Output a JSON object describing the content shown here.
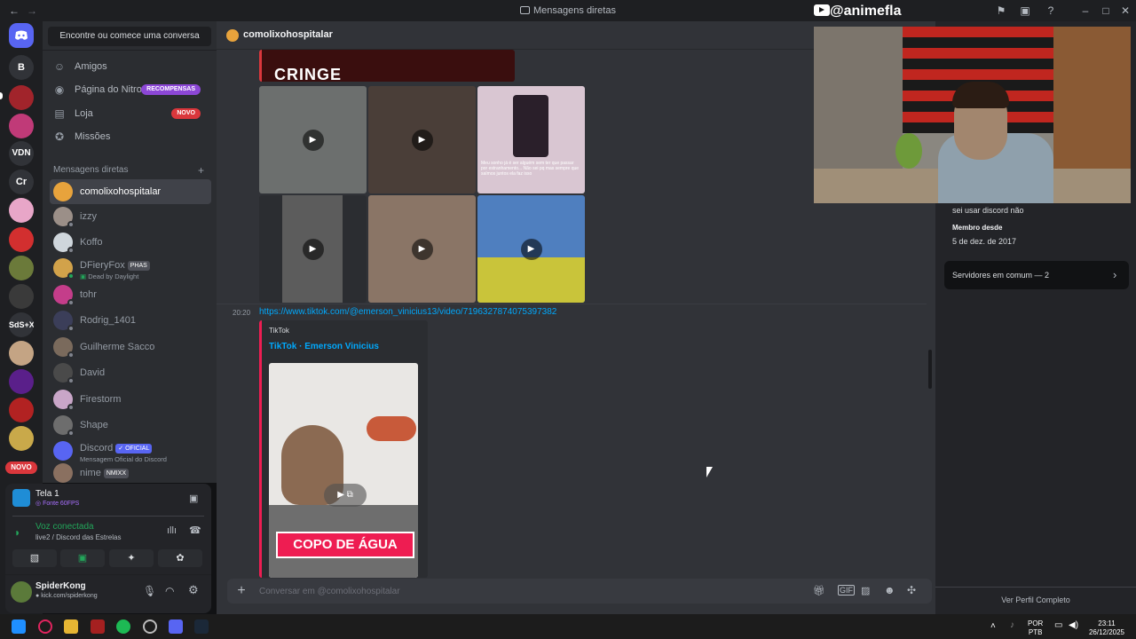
{
  "window": {
    "title": "Mensagens diretas"
  },
  "rail": {
    "letters": [
      "B",
      "VDN",
      "Cr",
      "SdS+X"
    ],
    "novo_badge": "NOVO"
  },
  "sidebar": {
    "search_label": "Encontre ou comece uma conversa",
    "nav": [
      {
        "label": "Amigos",
        "badge": ""
      },
      {
        "label": "Página do Nitro",
        "badge": "RECOMPENSAS"
      },
      {
        "label": "Loja",
        "badge": "NOVO"
      },
      {
        "label": "Missões",
        "badge": ""
      }
    ],
    "dm_header": "Mensagens diretas",
    "dms": [
      {
        "name": "comolixohospitalar",
        "sub": "",
        "tag": ""
      },
      {
        "name": "izzy",
        "sub": "",
        "tag": ""
      },
      {
        "name": "Koffo",
        "sub": "",
        "tag": ""
      },
      {
        "name": "DFieryFox",
        "sub": "Dead by Daylight",
        "tag": "PHAS"
      },
      {
        "name": "tohr",
        "sub": "",
        "tag": ""
      },
      {
        "name": "Rodrig_1401",
        "sub": "",
        "tag": ""
      },
      {
        "name": "Guilherme Sacco",
        "sub": "",
        "tag": ""
      },
      {
        "name": "David",
        "sub": "",
        "tag": ""
      },
      {
        "name": "Firestorm",
        "sub": "",
        "tag": ""
      },
      {
        "name": "Shape",
        "sub": "",
        "tag": ""
      },
      {
        "name": "Discord",
        "sub": "Mensagem Oficial do Discord",
        "tag": "OFICIAL"
      },
      {
        "name": "nime",
        "sub": "",
        "tag": "NMIXX"
      }
    ]
  },
  "panel": {
    "stream_title": "Tela 1",
    "stream_sub": "Fonte 60FPS",
    "voice_status": "Voz conectada",
    "voice_channel": "live2 / Discord das Estrelas",
    "user_name": "SpiderKong",
    "user_status": "kick.com/spiderkong"
  },
  "chat": {
    "recipient": "comolixohospitalar",
    "cringe_text": "CRINGE",
    "media_caption": "Meu sonho já é ser alguém sem ter que passar por estranhamento... Não sei pq mas sempre que saímos juntos ela faz isso",
    "message_time": "20:20",
    "message_link": "https://www.tiktok.com/@emerson_vinicius13/video/7196327874075397382",
    "embed_provider": "TikTok",
    "embed_title": "TikTok · Emerson Vinicius",
    "embed_overlay": "COPO DE ÁGUA",
    "composer_placeholder": "Conversar em @comolixohospitalar"
  },
  "profile": {
    "bio": "sei usar discord não",
    "member_since_label": "Membro desde",
    "member_since": "5 de dez. de 2017",
    "mutual_servers": "Servidores em comum — 2",
    "view_full": "Ver Perfil Completo"
  },
  "stream_overlay": {
    "channel": "@animefla"
  },
  "taskbar": {
    "lang": "POR",
    "layout": "PTB",
    "time": "23:11",
    "date": "26/12/2025"
  },
  "colors": {
    "blurple": "#5865f2",
    "green": "#23a55a",
    "red": "#da373c",
    "tiktok": "#ee1d52",
    "link": "#00a8fc"
  }
}
